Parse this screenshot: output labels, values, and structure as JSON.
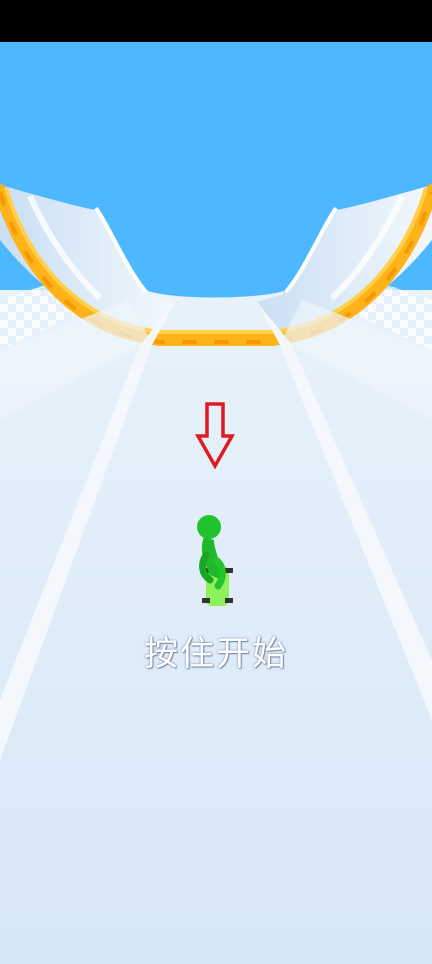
{
  "game": {
    "start_prompt": "按住开始"
  },
  "colors": {
    "sky": "#4db8ff",
    "track": "#d6e8f8",
    "track_edge": "#f4f8fc",
    "rail_orange": "#ffb31a",
    "character_green": "#22c42e",
    "skateboard_green": "#8ef05a",
    "arrow_red": "#e01a22"
  },
  "icons": {
    "hint_arrow": "arrow-down-outline-icon",
    "player": "stickman-on-skateboard"
  }
}
